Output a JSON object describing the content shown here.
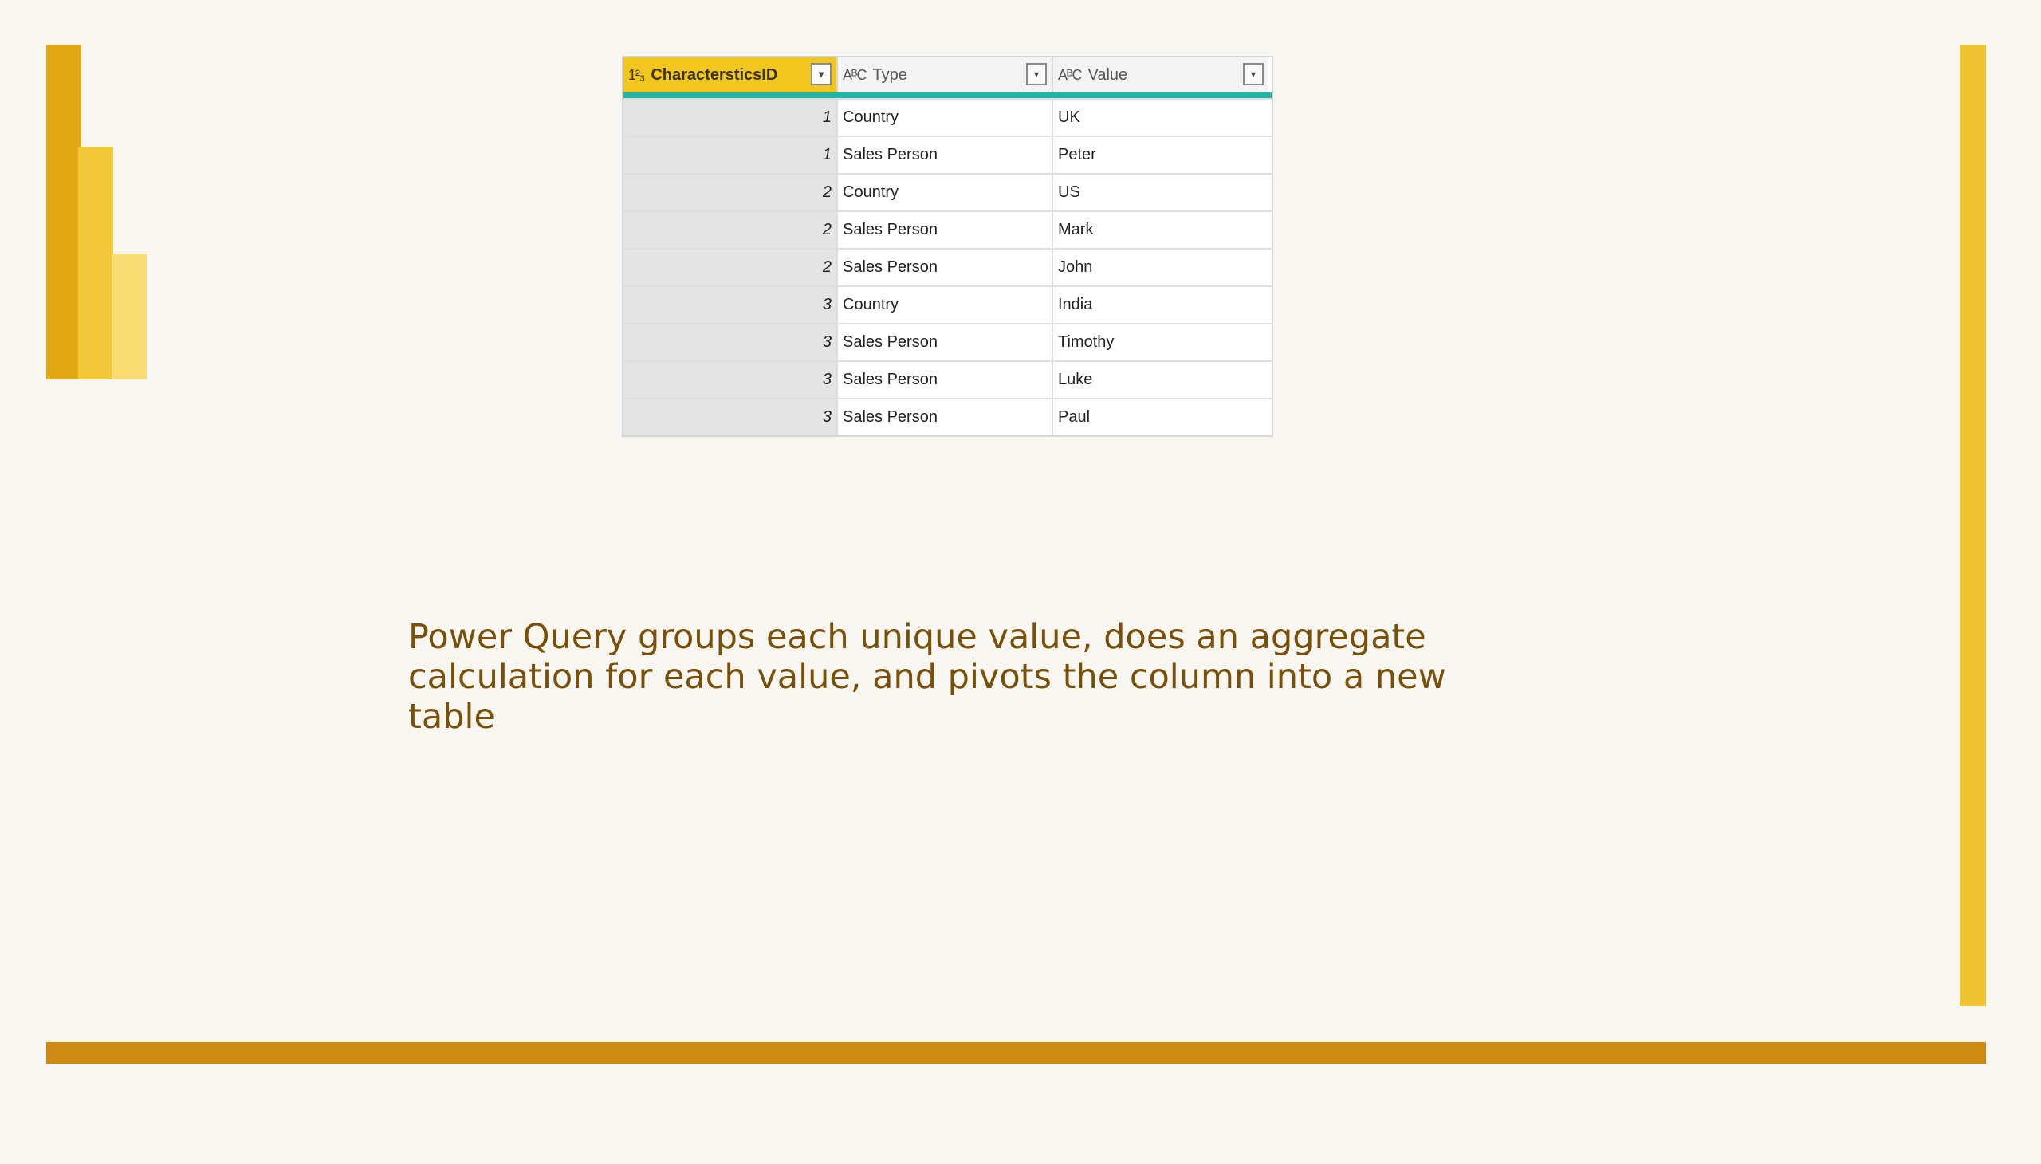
{
  "table": {
    "columns": [
      {
        "type_icon": "1²₃",
        "label": "CharactersticsID"
      },
      {
        "type_icon": "AᴮC",
        "label": "Type"
      },
      {
        "type_icon": "AᴮC",
        "label": "Value"
      }
    ],
    "dropdown_icon": "▾",
    "rows": [
      {
        "id": "1",
        "type": "Country",
        "value": "UK"
      },
      {
        "id": "1",
        "type": "Sales Person",
        "value": "Peter"
      },
      {
        "id": "2",
        "type": "Country",
        "value": "US"
      },
      {
        "id": "2",
        "type": "Sales Person",
        "value": "Mark"
      },
      {
        "id": "2",
        "type": "Sales Person",
        "value": "John"
      },
      {
        "id": "3",
        "type": "Country",
        "value": "India"
      },
      {
        "id": "3",
        "type": "Sales Person",
        "value": "Timothy"
      },
      {
        "id": "3",
        "type": "Sales Person",
        "value": "Luke"
      },
      {
        "id": "3",
        "type": "Sales Person",
        "value": "Paul"
      }
    ]
  },
  "caption": "Power Query groups each unique value, does an aggregate calculation for each value, and pivots the column into a new table",
  "colors": {
    "accent_gold": "#efc232",
    "accent_dark": "#cf8a12",
    "header_active": "#f1c71f",
    "header_underline": "#1fb5a7",
    "caption_text": "#7a4f08"
  }
}
